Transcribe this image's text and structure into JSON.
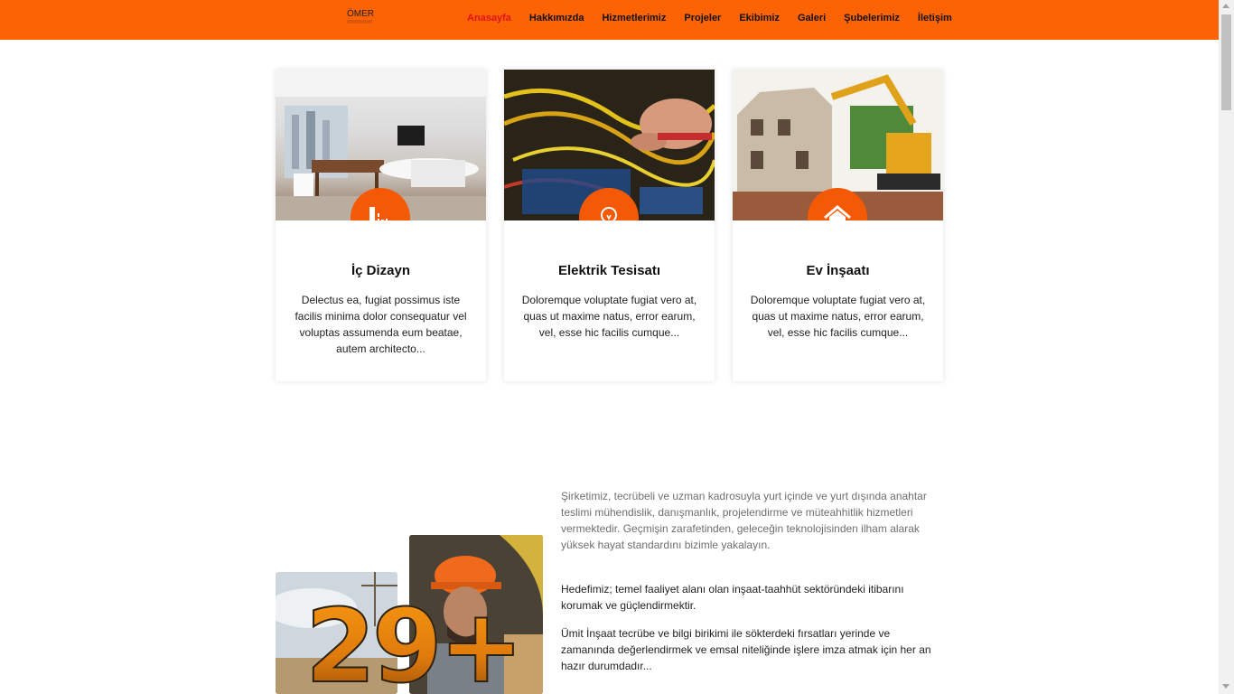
{
  "header": {
    "logo_text": "ÖMER",
    "nav": [
      {
        "label": "Anasayfa",
        "active": true
      },
      {
        "label": "Hakkımızda"
      },
      {
        "label": "Hizmetlerimiz"
      },
      {
        "label": "Projeler"
      },
      {
        "label": "Ekibimiz"
      },
      {
        "label": "Galeri"
      },
      {
        "label": "Şubelerimiz"
      },
      {
        "label": "İletişim"
      }
    ],
    "bar_color": "#fb6305",
    "active_color": "#e3121a"
  },
  "services": [
    {
      "title": "İç Dizayn",
      "icon": "ruler-square-icon",
      "text": "Delectus ea, fugiat possimus iste facilis minima dolor consequatur vel voluptas assumenda eum beatae, autem architecto..."
    },
    {
      "title": "Elektrik Tesisatı",
      "icon": "lightbulb-icon",
      "text": "Doloremque voluptate fugiat vero at, quas ut maxime natus, error earum, vel, esse hic facilis cumque..."
    },
    {
      "title": "Ev İnşaatı",
      "icon": "house-icon",
      "text": "Doloremque voluptate fugiat vero at, quas ut maxime natus, error earum, vel, esse hic facilis cumque..."
    }
  ],
  "about": {
    "badge": "29+",
    "paragraph1": "Şirketimiz, tecrübeli ve uzman kadrosuyla yurt içinde ve yurt dışında anahtar teslimi mühendislik, danışmanlık, projelendirme ve müteahhitlik hizmetleri vermektedir. Geçmişin zarafetinden, geleceğin teknolojisinden ilham alarak yüksek hayat standardını bizimle yakalayın.",
    "paragraph2": "Hedefimiz; temel faaliyet alanı olan inşaat-taahhüt sektöründeki itibarını korumak ve güçlendirmektir.",
    "paragraph3": "Ümit İnşaat tecrübe ve bilgi birikimi ile sökterdeki fırsatları yerinde ve zamanında değerlendirmek ve emsal niteliğinde işlere imza atmak için her an hazır durumdadır..."
  },
  "accent_color": "#f45a06"
}
